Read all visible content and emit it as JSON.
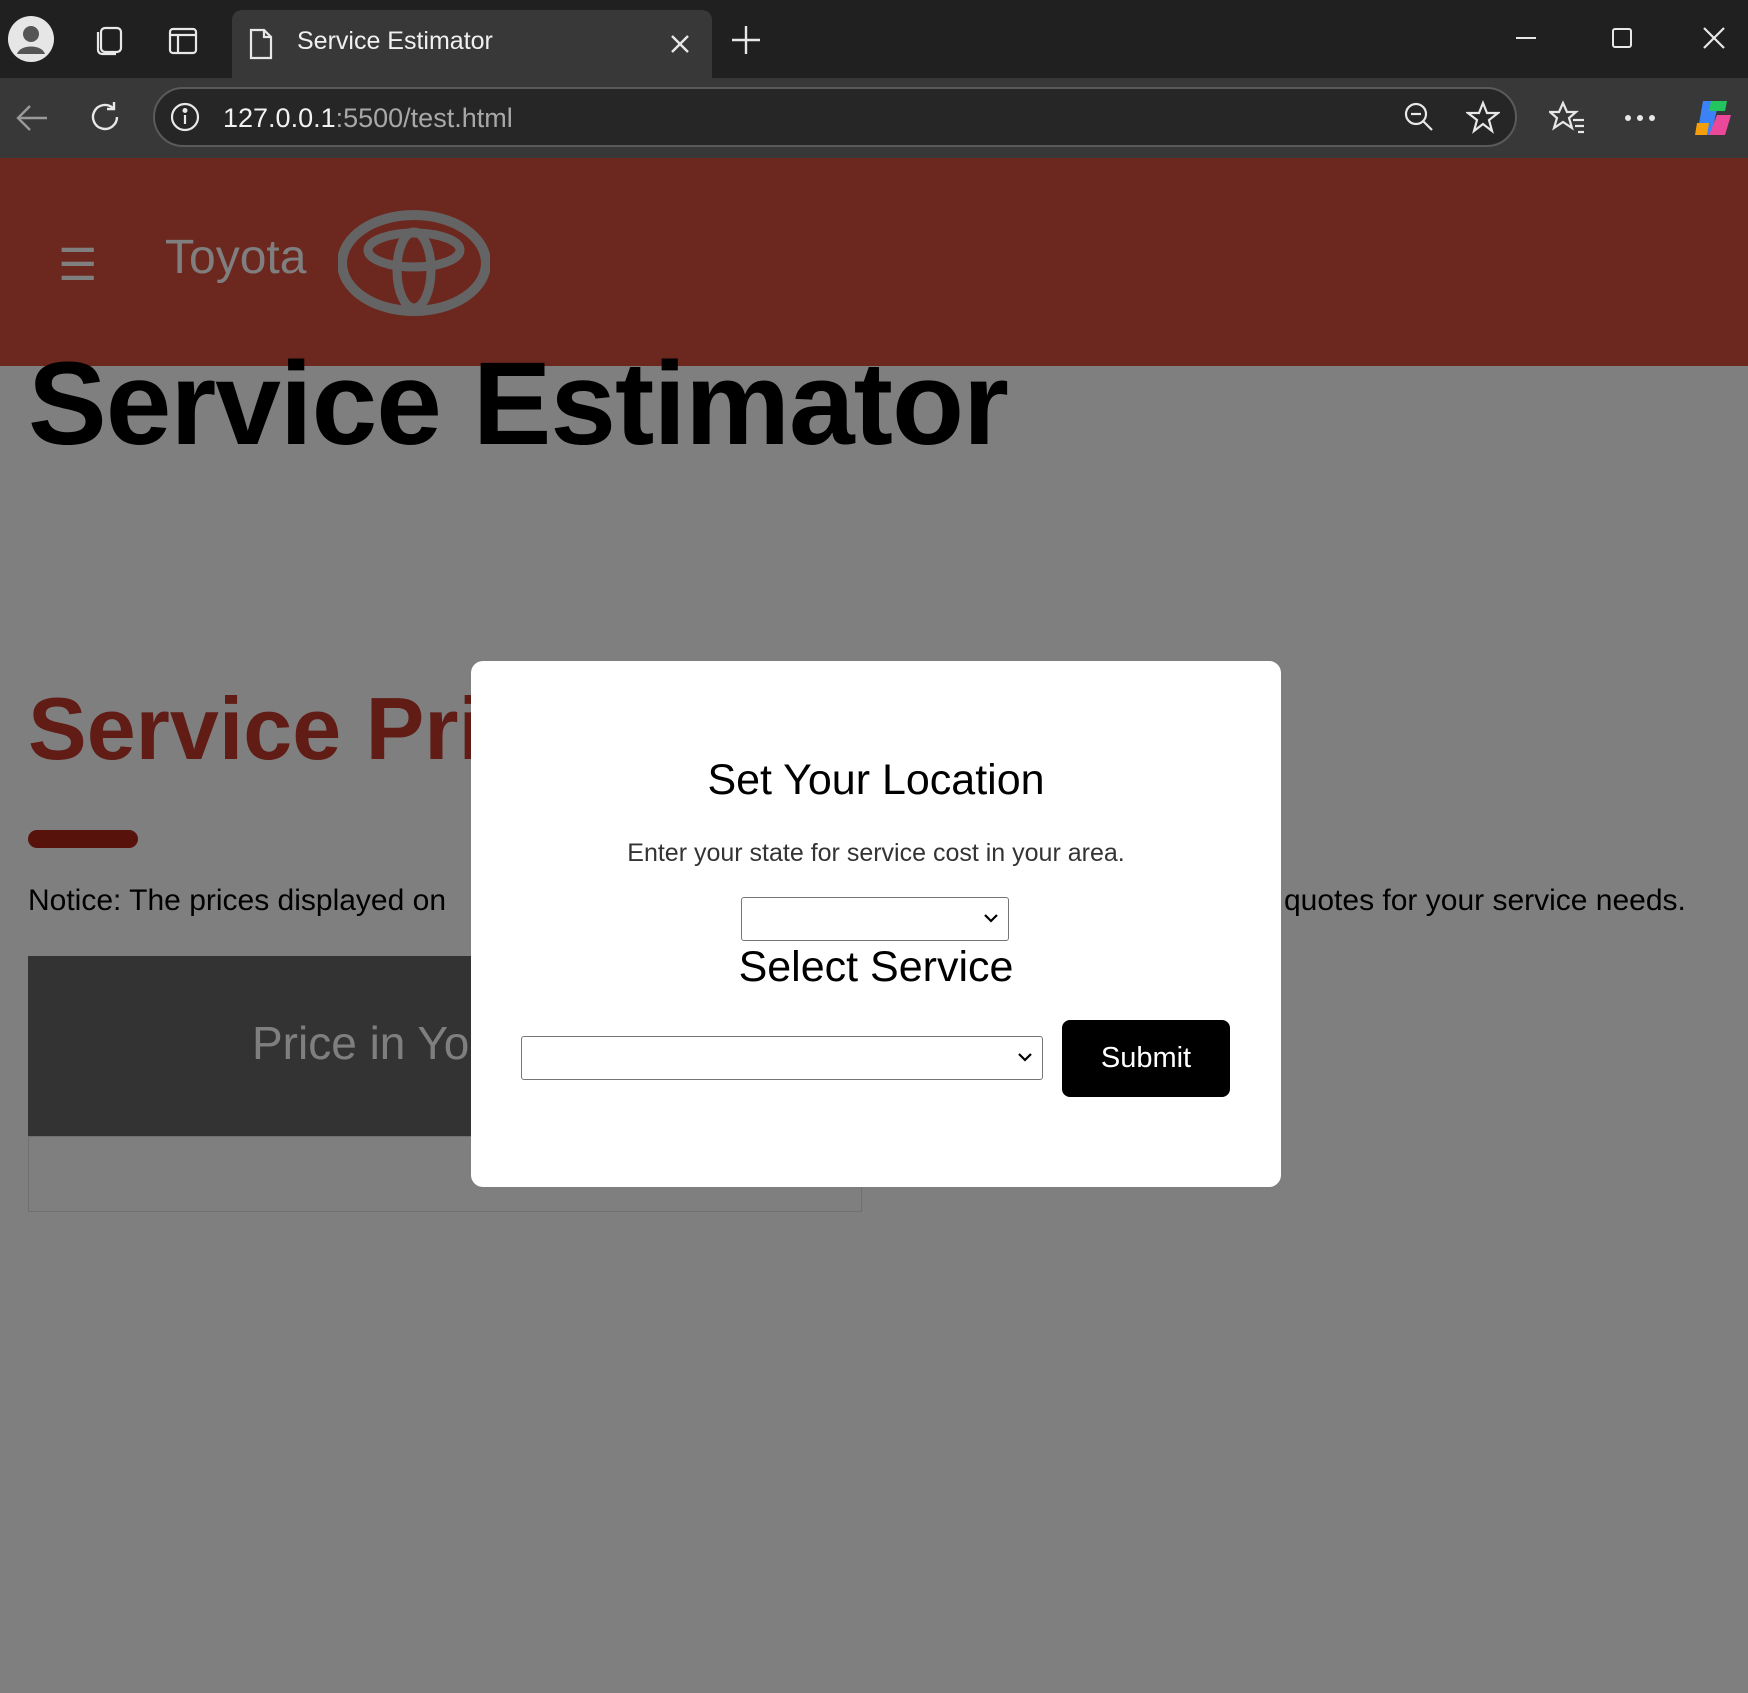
{
  "browser": {
    "tab_title": "Service Estimator",
    "url_host": "127.0.0.1",
    "url_rest": ":5500/test.html"
  },
  "header": {
    "brand": "Toyota",
    "menu_icon": "☰",
    "background_color": "#d94f3d"
  },
  "main": {
    "title": "Service Estimator",
    "section_title_visible": "Service Pri",
    "notice_left": "Notice: The prices displayed on",
    "notice_right": "quotes for your service needs.",
    "price_card_title_visible": "Price in Yo"
  },
  "modal": {
    "title": "Set Your Location",
    "description": "Enter your state for service cost in your area.",
    "state_select_value": "",
    "service_title": "Select Service",
    "service_select_value": "",
    "submit_label": "Submit"
  },
  "icons": [
    "profile-icon",
    "workspaces-icon",
    "vertical-tabs-icon",
    "page-icon",
    "close-tab-icon",
    "new-tab-icon",
    "minimize-icon",
    "maximize-icon",
    "close-window-icon",
    "back-icon",
    "refresh-icon",
    "site-info-icon",
    "zoom-out-icon",
    "favorite-star-icon",
    "favorites-icon",
    "more-icon",
    "copilot-icon",
    "hamburger-icon",
    "toyota-logo",
    "chevron-down-icon"
  ]
}
